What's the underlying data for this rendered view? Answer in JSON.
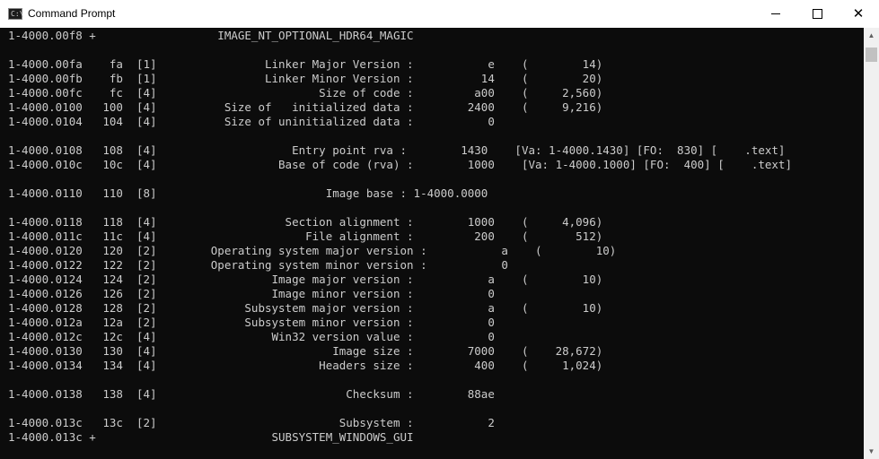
{
  "window": {
    "title": "Command Prompt",
    "icon_label": "C:\\",
    "controls": {
      "minimize": "minimize-icon",
      "maximize": "maximize-icon",
      "close": "✕"
    }
  },
  "scrollbar": {
    "up_arrow": "▲",
    "down_arrow": "▼"
  },
  "console": {
    "lines": [
      "1-4000.00f8 +                  IMAGE_NT_OPTIONAL_HDR64_MAGIC",
      "",
      "1-4000.00fa    fa  [1]                Linker Major Version :           e    (        14)",
      "1-4000.00fb    fb  [1]                Linker Minor Version :          14    (        20)",
      "1-4000.00fc    fc  [4]                        Size of code :         a00    (     2,560)",
      "1-4000.0100   100  [4]          Size of   initialized data :        2400    (     9,216)",
      "1-4000.0104   104  [4]          Size of uninitialized data :           0",
      "",
      "1-4000.0108   108  [4]                    Entry point rva :        1430    [Va: 1-4000.1430] [FO:  830] [    .text]",
      "1-4000.010c   10c  [4]                  Base of code (rva) :        1000    [Va: 1-4000.1000] [FO:  400] [    .text]",
      "",
      "1-4000.0110   110  [8]                         Image base : 1-4000.0000",
      "",
      "1-4000.0118   118  [4]                   Section alignment :        1000    (     4,096)",
      "1-4000.011c   11c  [4]                      File alignment :         200    (       512)",
      "1-4000.0120   120  [2]        Operating system major version :           a    (        10)",
      "1-4000.0122   122  [2]        Operating system minor version :           0",
      "1-4000.0124   124  [2]                 Image major version :           a    (        10)",
      "1-4000.0126   126  [2]                 Image minor version :           0",
      "1-4000.0128   128  [2]             Subsystem major version :           a    (        10)",
      "1-4000.012a   12a  [2]             Subsystem minor version :           0",
      "1-4000.012c   12c  [4]                 Win32 version value :           0",
      "1-4000.0130   130  [4]                          Image size :        7000    (    28,672)",
      "1-4000.0134   134  [4]                        Headers size :         400    (     1,024)",
      "",
      "1-4000.0138   138  [4]                            Checksum :        88ae",
      "",
      "1-4000.013c   13c  [2]                           Subsystem :           2",
      "1-4000.013c +                          SUBSYSTEM_WINDOWS_GUI"
    ]
  }
}
